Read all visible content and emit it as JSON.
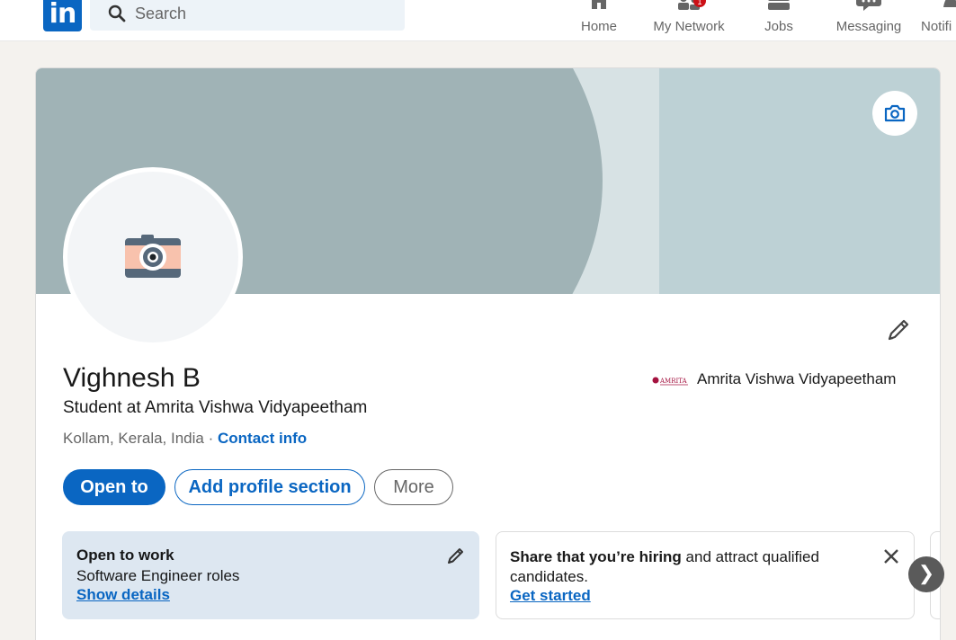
{
  "nav": {
    "logo_text": "in",
    "search_placeholder": "Search",
    "items": [
      {
        "label": "Home",
        "icon": "home-icon"
      },
      {
        "label": "My Network",
        "icon": "network-icon",
        "badge": "1"
      },
      {
        "label": "Jobs",
        "icon": "briefcase-icon"
      },
      {
        "label": "Messaging",
        "icon": "chat-icon"
      },
      {
        "label": "Notifi",
        "icon": "bell-icon"
      }
    ]
  },
  "profile": {
    "name": "Vighnesh B",
    "headline": "Student at Amrita Vishwa Vidyapeetham",
    "location": "Kollam, Kerala, India",
    "separator": " · ",
    "contact_link": "Contact info",
    "education": {
      "logo_text": "AMRITA",
      "name": "Amrita Vishwa Vidyapeetham"
    },
    "buttons": {
      "open_to": "Open to",
      "add_section": "Add profile section",
      "more": "More"
    }
  },
  "open_to_work": {
    "title": "Open to work",
    "roles": "Software Engineer roles",
    "link": "Show details"
  },
  "hiring": {
    "bold_text": "Share that you’re hiring",
    "rest_text": " and attract qualified candidates.",
    "link": "Get started"
  },
  "carousel": {
    "next_label": "❯"
  },
  "colors": {
    "brand": "#0a66c2",
    "banner_dark": "#a0b3b6",
    "banner_light": "#bdd1d5",
    "open_to_work_bg": "#dde7f1",
    "badge": "#cc1016"
  }
}
